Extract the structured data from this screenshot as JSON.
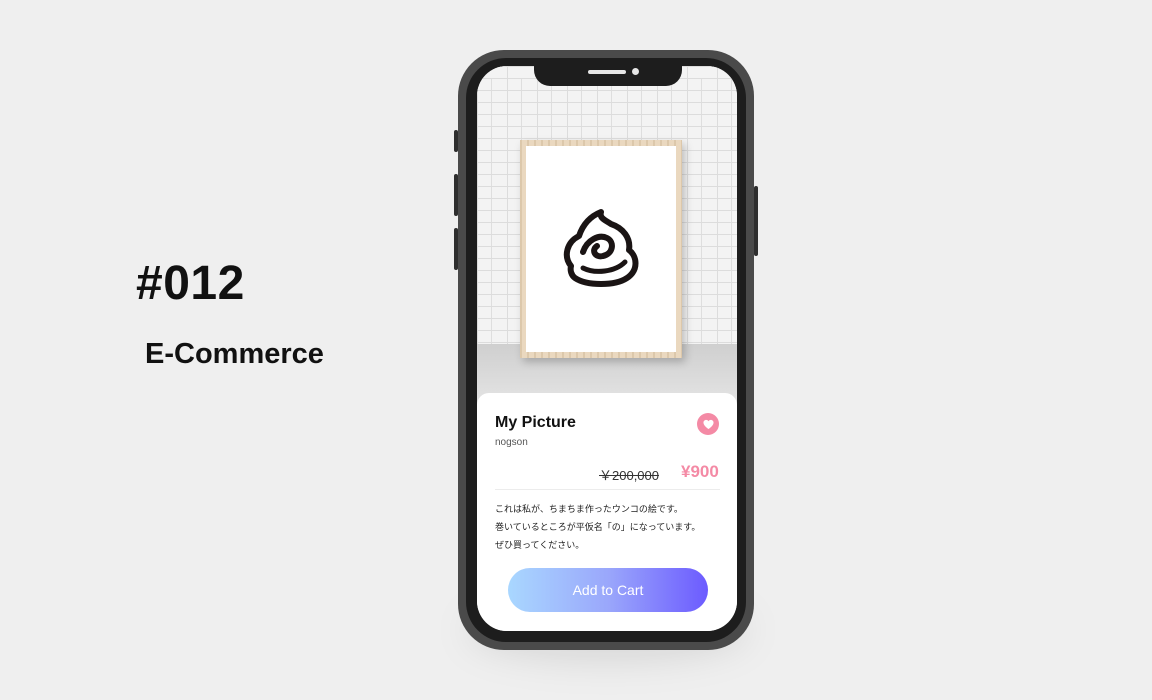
{
  "presentation": {
    "number": "#012",
    "title": "E-Commerce"
  },
  "product": {
    "name": "My Picture",
    "artist": "nogson",
    "original_price": "￥200,000",
    "price": "¥900",
    "description": [
      "これは私が、ちまちま作ったウンコの絵です。",
      "巻いているところが平仮名「の」になっています。",
      "ぜひ買ってください。"
    ],
    "cart_button_label": "Add to Cart",
    "favorite_icon": "heart-icon"
  },
  "colors": {
    "accent_pink": "#f48aa5",
    "button_gradient_start": "#a9d7ff",
    "button_gradient_end": "#6c5bff",
    "background": "#efefef",
    "phone_body": "#4a4a4a"
  }
}
